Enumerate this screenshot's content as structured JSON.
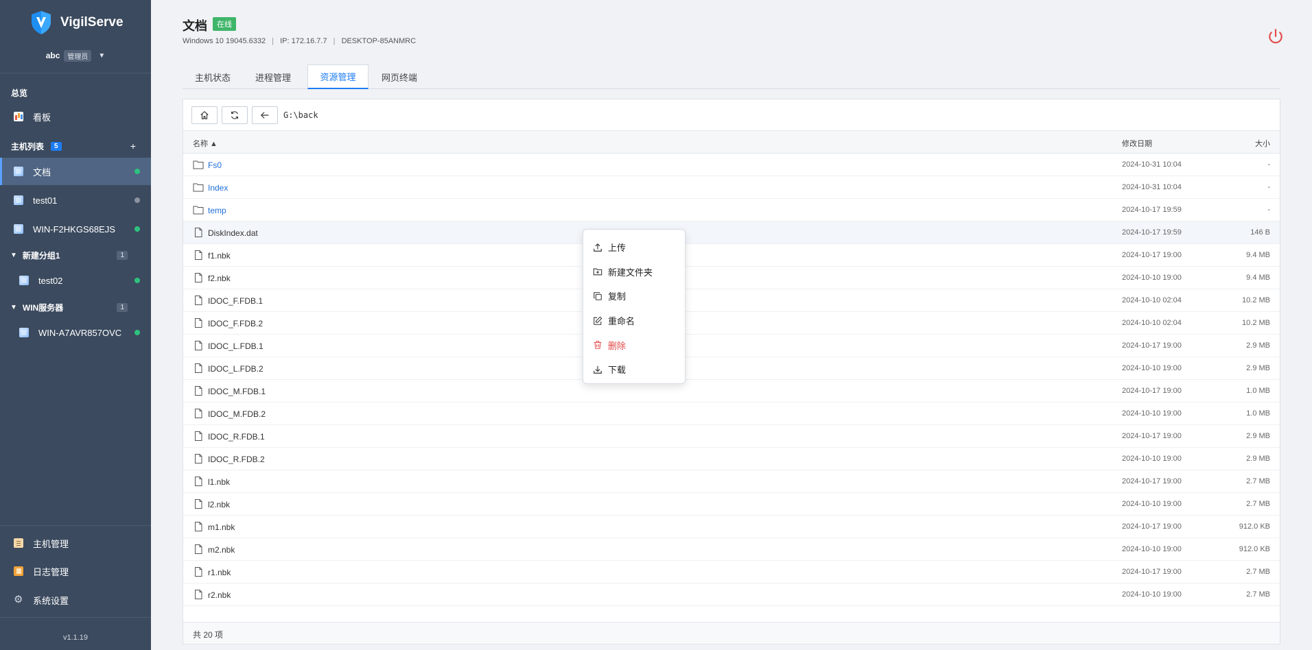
{
  "brand": {
    "name": "VigilServe"
  },
  "user": {
    "name": "abc",
    "role": "管理员",
    "caret": "▼"
  },
  "sidebar": {
    "overview_label": "总览",
    "dashboard_label": "看板",
    "host_list_label": "主机列表",
    "host_count": "5",
    "add": "+",
    "hosts": [
      {
        "label": "文档",
        "status": "online"
      },
      {
        "label": "test01",
        "status": "offline"
      },
      {
        "label": "WIN-F2HKGS68EJS",
        "status": "online"
      }
    ],
    "groups": [
      {
        "label": "新建分组1",
        "count": "1",
        "caret": "▼",
        "hosts": [
          {
            "label": "test02",
            "status": "online"
          }
        ]
      },
      {
        "label": "WIN服务器",
        "count": "1",
        "caret": "▼",
        "hosts": [
          {
            "label": "WIN-A7AVR857OVC",
            "status": "online"
          }
        ]
      }
    ],
    "bottom": [
      {
        "label": "主机管理",
        "icon": "clipboard-icon"
      },
      {
        "label": "日志管理",
        "icon": "log-icon"
      },
      {
        "label": "系统设置",
        "icon": "gear-icon"
      }
    ],
    "version": "v1.1.19"
  },
  "colors": {
    "online": "#2ec27e",
    "offline": "#8a939e",
    "accent": "#1d7cf2",
    "danger": "#e34b4b",
    "sidebar": "#3b4a5e"
  },
  "host": {
    "title": "文档",
    "status": "在线",
    "os": "Windows 10 19045.6332",
    "ip": "IP: 172.16.7.7",
    "machine": "DESKTOP-85ANMRC"
  },
  "tabs": [
    {
      "label": "主机状态"
    },
    {
      "label": "进程管理"
    },
    {
      "label": "资源管理",
      "active": true
    },
    {
      "label": "网页终端"
    }
  ],
  "explorer": {
    "path": "G:\\back",
    "columns": {
      "name": "名称 ▲",
      "date": "修改日期",
      "size": "大小"
    },
    "files": [
      {
        "name": "Fs0",
        "type": "folder",
        "date": "2024-10-31 10:04",
        "size": "-"
      },
      {
        "name": "Index",
        "type": "folder",
        "date": "2024-10-31 10:04",
        "size": "-"
      },
      {
        "name": "temp",
        "type": "folder",
        "date": "2024-10-17 19:59",
        "size": "-"
      },
      {
        "name": "DiskIndex.dat",
        "type": "file",
        "date": "2024-10-17 19:59",
        "size": "146 B"
      },
      {
        "name": "f1.nbk",
        "type": "file",
        "date": "2024-10-17 19:00",
        "size": "9.4 MB"
      },
      {
        "name": "f2.nbk",
        "type": "file",
        "date": "2024-10-10 19:00",
        "size": "9.4 MB"
      },
      {
        "name": "IDOC_F.FDB.1",
        "type": "file",
        "date": "2024-10-10 02:04",
        "size": "10.2 MB"
      },
      {
        "name": "IDOC_F.FDB.2",
        "type": "file",
        "date": "2024-10-10 02:04",
        "size": "10.2 MB"
      },
      {
        "name": "IDOC_L.FDB.1",
        "type": "file",
        "date": "2024-10-17 19:00",
        "size": "2.9 MB"
      },
      {
        "name": "IDOC_L.FDB.2",
        "type": "file",
        "date": "2024-10-10 19:00",
        "size": "2.9 MB"
      },
      {
        "name": "IDOC_M.FDB.1",
        "type": "file",
        "date": "2024-10-17 19:00",
        "size": "1.0 MB"
      },
      {
        "name": "IDOC_M.FDB.2",
        "type": "file",
        "date": "2024-10-10 19:00",
        "size": "1.0 MB"
      },
      {
        "name": "IDOC_R.FDB.1",
        "type": "file",
        "date": "2024-10-17 19:00",
        "size": "2.9 MB"
      },
      {
        "name": "IDOC_R.FDB.2",
        "type": "file",
        "date": "2024-10-10 19:00",
        "size": "2.9 MB"
      },
      {
        "name": "l1.nbk",
        "type": "file",
        "date": "2024-10-17 19:00",
        "size": "2.7 MB"
      },
      {
        "name": "l2.nbk",
        "type": "file",
        "date": "2024-10-10 19:00",
        "size": "2.7 MB"
      },
      {
        "name": "m1.nbk",
        "type": "file",
        "date": "2024-10-17 19:00",
        "size": "912.0 KB"
      },
      {
        "name": "m2.nbk",
        "type": "file",
        "date": "2024-10-10 19:00",
        "size": "912.0 KB"
      },
      {
        "name": "r1.nbk",
        "type": "file",
        "date": "2024-10-17 19:00",
        "size": "2.7 MB"
      },
      {
        "name": "r2.nbk",
        "type": "file",
        "date": "2024-10-10 19:00",
        "size": "2.7 MB"
      }
    ],
    "footer": "共 20 项"
  },
  "context_menu": {
    "items": [
      {
        "label": "上传",
        "icon": "upload-icon"
      },
      {
        "label": "新建文件夹",
        "icon": "new-folder-icon"
      },
      {
        "label": "复制",
        "icon": "copy-icon"
      },
      {
        "label": "重命名",
        "icon": "rename-icon"
      },
      {
        "label": "删除",
        "icon": "delete-icon",
        "danger": true
      },
      {
        "label": "下载",
        "icon": "download-icon"
      }
    ]
  }
}
